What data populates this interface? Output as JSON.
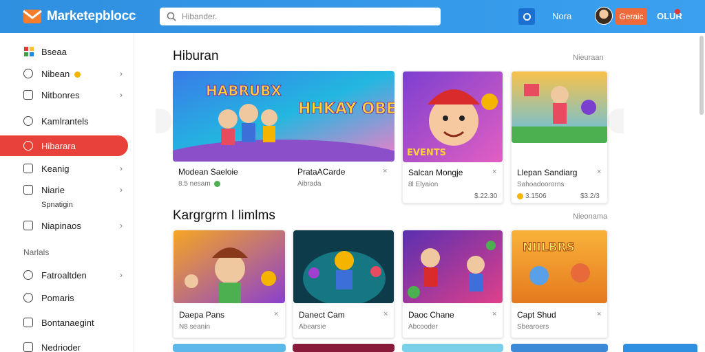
{
  "header": {
    "brand": "Marketepblocc",
    "search_placeholder": "Hibander.",
    "link": "Nora",
    "button": "Geraic",
    "user": "OLUR"
  },
  "sidebar": {
    "items": [
      {
        "label": "Bseaa",
        "icon": "grid-icon"
      },
      {
        "label": "Nibean",
        "icon": "coin-icon"
      },
      {
        "label": "Nitbonres",
        "icon": "monitor-icon"
      },
      {
        "label": "Kamlrantels",
        "icon": "circle-icon"
      },
      {
        "label": "Hibarara",
        "icon": "record-icon"
      },
      {
        "label": "Keanig",
        "icon": "chart-icon"
      },
      {
        "label": "Niarie",
        "sub": "Spnatigin",
        "icon": "doc-icon"
      },
      {
        "label": "Niapinaos",
        "icon": "image-icon"
      }
    ],
    "section_head": "Narlals",
    "items2": [
      {
        "label": "Fatroaltden",
        "icon": "globe-icon"
      },
      {
        "label": "Pomaris",
        "icon": "chat-icon"
      },
      {
        "label": "Bontanaegint",
        "icon": "user-icon"
      },
      {
        "label": "Nedrioder",
        "icon": "doc-icon"
      }
    ]
  },
  "sections": [
    {
      "title": "Hiburan",
      "see_all": "Nieuraan",
      "cards": [
        {
          "title": "Modean Saeloie",
          "sub": "8.5 nesam",
          "banner": "HABRUBX",
          "banner2": "HHKAY OBERAS"
        },
        {
          "title": "PrataACarde",
          "sub": "Aibrada"
        },
        {
          "title": "Salcan Mongje",
          "sub": "8l Elyaion",
          "price": "$.22.30",
          "banner": "EVENTS"
        },
        {
          "title": "Llepan Sandiarg",
          "sub": "Sahoadoororns",
          "price_left": "3.1506",
          "price": "$3.2/3"
        }
      ]
    },
    {
      "title": "Kargrgrm I limlms",
      "see_all": "Nieonama",
      "cards": [
        {
          "title": "Daepa Pans",
          "sub": "N8 seanin"
        },
        {
          "title": "Danect Cam",
          "sub": "Abearsie"
        },
        {
          "title": "Daoc Chane",
          "sub": "Abcooder"
        },
        {
          "title": "Capt Shud",
          "sub": "Sbearoers",
          "banner": "NIILBRS"
        }
      ]
    }
  ],
  "colors": {
    "header": "#2f8fe0",
    "active": "#e8413a",
    "accent_button": "#ef6a3a"
  }
}
